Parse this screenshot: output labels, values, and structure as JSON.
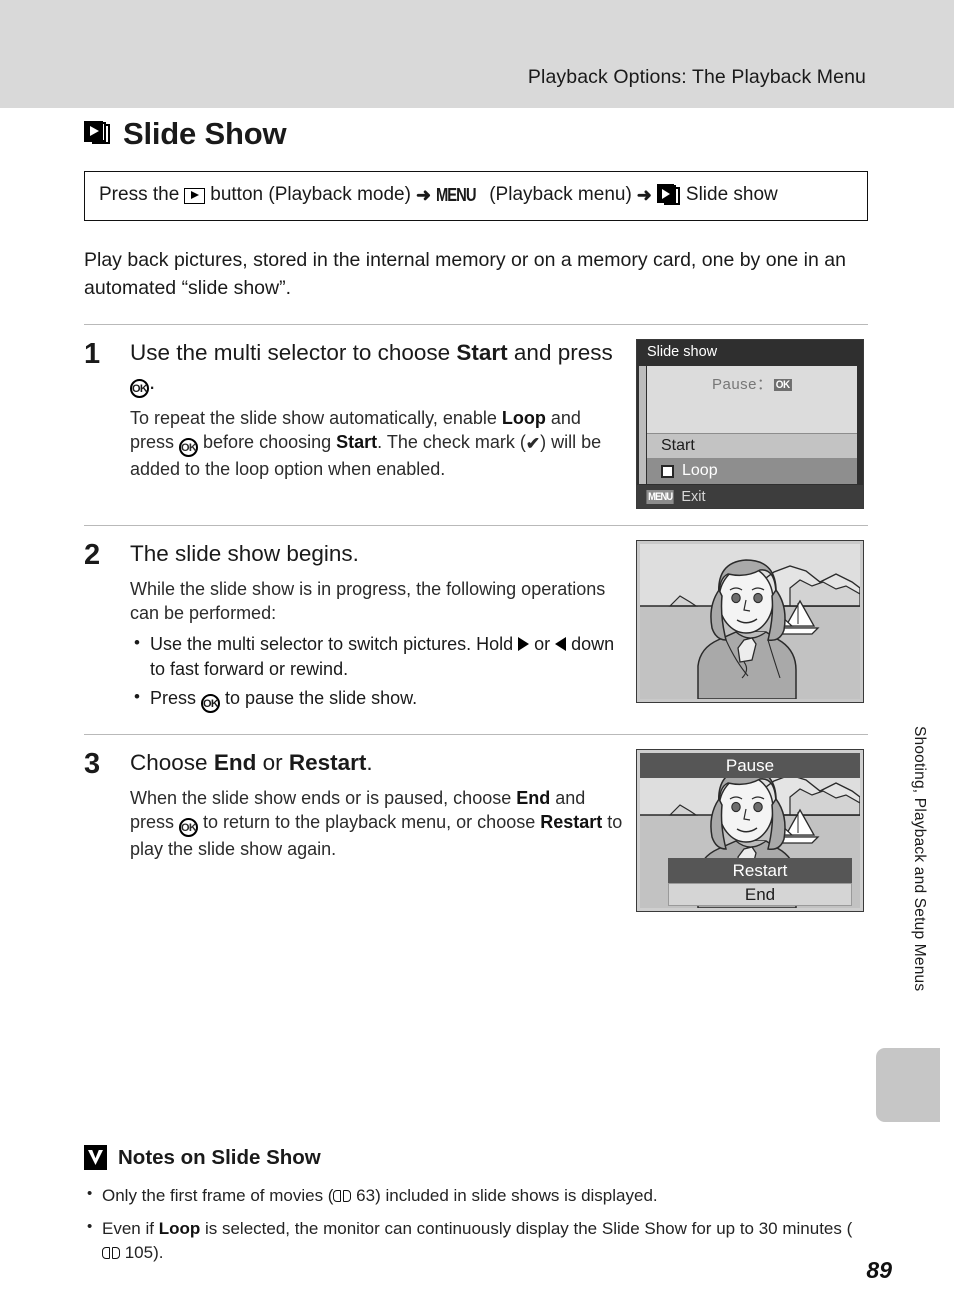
{
  "header": {
    "running_title": "Playback Options: The Playback Menu"
  },
  "section": {
    "icon": "slideshow-icon",
    "title": "Slide Show"
  },
  "path_box": {
    "prefix": "Press the",
    "playback_icon": "playback-icon",
    "button_word": "button (Playback mode)",
    "arrow1": "➜",
    "menu_glyph": "MENU",
    "menu_word": "(Playback menu)",
    "arrow2": "➜",
    "slideshow_icon": "slideshow-icon",
    "target": "Slide show"
  },
  "intro": "Play back pictures, stored in the internal memory or on a memory card, one by one in an automated “slide show”.",
  "steps": [
    {
      "num": "1",
      "title_pre": "Use the multi selector to choose ",
      "title_bold": "Start",
      "title_mid": " and press ",
      "title_ok": "OK",
      "title_post": ".",
      "body_1": "To repeat the slide show automatically, enable ",
      "body_bold_1": "Loop",
      "body_2": " and press ",
      "body_ok": "OK",
      "body_3": " before choosing ",
      "body_bold_2": "Start",
      "body_4": ". The check mark (",
      "body_check": "✔",
      "body_5": ") will be added to the loop option when enabled."
    },
    {
      "num": "2",
      "title": "The slide show begins.",
      "body": "While the slide show is in progress, the following operations can be performed:",
      "bullets": [
        {
          "pre": "Use the multi selector to switch pictures. Hold ",
          "icon_right": "triangle-right-icon",
          "mid": " or ",
          "icon_left": "triangle-left-icon",
          "post": " down to fast forward or rewind."
        },
        {
          "pre": "Press ",
          "ok": "OK",
          "post": " to pause the slide show."
        }
      ]
    },
    {
      "num": "3",
      "title_pre": "Choose ",
      "title_bold_1": "End",
      "title_mid": " or ",
      "title_bold_2": "Restart",
      "title_post": ".",
      "body_1": "When the slide show ends or is paused, choose ",
      "body_bold_1": "End",
      "body_2": " and press ",
      "body_ok": "OK",
      "body_3": " to return to the playback menu, or choose ",
      "body_bold_2": "Restart",
      "body_4": " to play the slide show again."
    }
  ],
  "screens": {
    "menu": {
      "title": "Slide show",
      "pause_label": "Pause",
      "pause_sep": "：",
      "pause_ok": "OK",
      "start": "Start",
      "loop": "Loop",
      "loop_checked": false,
      "menu_glyph": "MENU",
      "exit": "Exit"
    },
    "photo": {
      "alt": "slide-show-picture"
    },
    "pause": {
      "top_label": "Pause",
      "restart": "Restart",
      "end": "End"
    }
  },
  "notes": {
    "icon": "caution-icon",
    "heading": "Notes on Slide Show",
    "items": [
      {
        "pre": "Only the first frame of movies (",
        "ref": " 63",
        "post": ") included in slide shows is displayed."
      },
      {
        "pre": "Even if ",
        "bold": "Loop",
        "mid": " is selected, the monitor can continuously display the Slide Show for up to 30 minutes (",
        "ref": " 105",
        "post": ")."
      }
    ]
  },
  "side_tab": {
    "label": "Shooting, Playback and Setup Menus"
  },
  "page_number": "89",
  "colors": {
    "header_band": "#d9d9d9",
    "rule": "#b9b9b9",
    "screen_dark": "#2f2f2f",
    "screen_light": "#dcdcdc",
    "highlight_row": "#c3c3c3",
    "loop_row": "#8e8e8e",
    "overlay_bar": "#565656",
    "tab_marker": "#c6c6c6"
  }
}
